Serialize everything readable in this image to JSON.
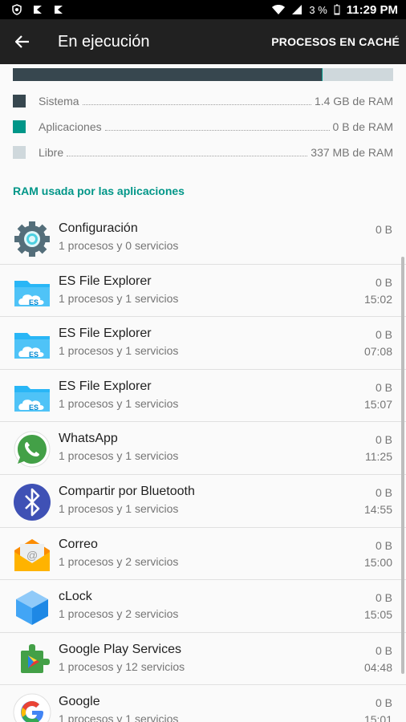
{
  "status_bar": {
    "battery": "3 %",
    "time": "11:29 PM"
  },
  "toolbar": {
    "title": "En ejecución",
    "action": "PROCESOS EN CACHÉ"
  },
  "ram": {
    "colors": {
      "system": "#37474f",
      "apps": "#009688",
      "free": "#cfd8dc"
    },
    "legend": [
      {
        "label": "Sistema",
        "value": "1.4 GB de RAM"
      },
      {
        "label": "Aplicaciones",
        "value": "0 B de RAM"
      },
      {
        "label": "Libre",
        "value": "337 MB de RAM"
      }
    ]
  },
  "section_title": "RAM usada por las aplicaciones",
  "apps": [
    {
      "name": "Configuración",
      "detail": "1 procesos y 0 servicios",
      "size": "0 B",
      "time": "",
      "icon": "settings-icon"
    },
    {
      "name": "ES File Explorer",
      "detail": "1 procesos y 1 servicios",
      "size": "0 B",
      "time": "15:02",
      "icon": "es-file-explorer-icon"
    },
    {
      "name": "ES File Explorer",
      "detail": "1 procesos y 1 servicios",
      "size": "0 B",
      "time": "07:08",
      "icon": "es-file-explorer-icon"
    },
    {
      "name": "ES File Explorer",
      "detail": "1 procesos y 1 servicios",
      "size": "0 B",
      "time": "15:07",
      "icon": "es-file-explorer-icon"
    },
    {
      "name": "WhatsApp",
      "detail": "1 procesos y 1 servicios",
      "size": "0 B",
      "time": "11:25",
      "icon": "whatsapp-icon"
    },
    {
      "name": "Compartir por Bluetooth",
      "detail": "1 procesos y 1 servicios",
      "size": "0 B",
      "time": "14:55",
      "icon": "bluetooth-icon"
    },
    {
      "name": "Correo",
      "detail": "1 procesos y 2 servicios",
      "size": "0 B",
      "time": "15:00",
      "icon": "mail-icon"
    },
    {
      "name": "cLock",
      "detail": "1 procesos y 2 servicios",
      "size": "0 B",
      "time": "15:05",
      "icon": "clock-cube-icon"
    },
    {
      "name": "Google Play Services",
      "detail": "1 procesos y 12 servicios",
      "size": "0 B",
      "time": "04:48",
      "icon": "play-services-icon"
    },
    {
      "name": "Google",
      "detail": "1 procesos y 1 servicios",
      "size": "0 B",
      "time": "15:01",
      "icon": "google-icon"
    }
  ]
}
